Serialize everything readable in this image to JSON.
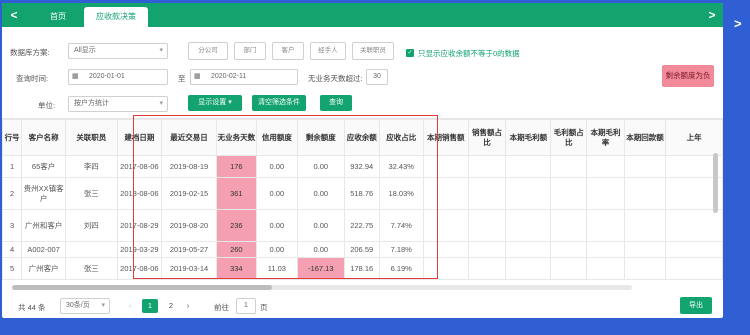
{
  "tabs": {
    "left_arrow": "<",
    "right_arrow": ">",
    "items": [
      {
        "label": "首页"
      },
      {
        "label": "应收款决策"
      }
    ]
  },
  "filters": {
    "data_mode_label": "数据库方案:",
    "data_mode_value": "All显示",
    "chips": [
      "分公司",
      "部门",
      "客户",
      "经手人",
      "关联职员"
    ],
    "only_show_text": "只显示应收余额不等于0的数据",
    "date_label": "查询时间:",
    "date_from": "2020-01-01",
    "date_to_label": "至",
    "date_to": "2020-02-11",
    "no_trade_label": "无业务天数超过:",
    "no_trade_value": "30",
    "unit_label": "单位:",
    "unit_value": "按户方统计",
    "show_settings_btn": "显示设置 ▾",
    "clear_btn": "清空筛选条件",
    "query_btn": "查询",
    "remaining_btn": "剩余额度为负"
  },
  "table": {
    "headers": [
      "行号",
      "客户名称",
      "关联职员",
      "建档日期",
      "最近交易日",
      "无业务天数",
      "信用额度",
      "剩余额度",
      "应收余额",
      "应收占比",
      "本期销售额",
      "销售额占比",
      "本期毛利额",
      "毛利额占比",
      "本期毛利率",
      "本期回款额",
      "上年"
    ],
    "rows": [
      {
        "no": "1",
        "name": "65客户",
        "staff": "李四",
        "created": "2017-08-06",
        "last": "2019-08-19",
        "days": "176",
        "credit": "0.00",
        "remain": "0.00",
        "recv": "932.94",
        "ratio": "32.43%"
      },
      {
        "no": "2",
        "name": "贵州XX镇客户",
        "staff": "张三",
        "created": "2018-08-06",
        "last": "2019-02-15",
        "days": "361",
        "credit": "0.00",
        "remain": "0.00",
        "recv": "518.76",
        "ratio": "18.03%"
      },
      {
        "no": "3",
        "name": "广州和客户",
        "staff": "刘四",
        "created": "2017-08-29",
        "last": "2019-08-20",
        "days": "236",
        "credit": "0.00",
        "remain": "0.00",
        "recv": "222.75",
        "ratio": "7.74%"
      },
      {
        "no": "4",
        "name": "A002-007",
        "staff": "",
        "created": "2019-03-29",
        "last": "2019-05-27",
        "days": "260",
        "credit": "0.00",
        "remain": "0.00",
        "recv": "206.59",
        "ratio": "7.18%"
      },
      {
        "no": "5",
        "name": "广州客户",
        "staff": "张三",
        "created": "2017-08-06",
        "last": "2019-03-14",
        "days": "334",
        "credit": "11.03",
        "remain": "-167.13",
        "recv": "178.16",
        "ratio": "6.19%"
      }
    ]
  },
  "footer": {
    "total": "共 44 条",
    "page_size": "30条/页",
    "pages": [
      "1",
      "2"
    ],
    "goto_label": "前往",
    "goto_value": "1",
    "goto_unit": "页",
    "export_btn": "导出"
  },
  "colors": {
    "green": "#12a36e",
    "pink_cell": "#f4a0b2",
    "red_box": "#e23a3a",
    "background_blue": "#2f5fd3"
  }
}
